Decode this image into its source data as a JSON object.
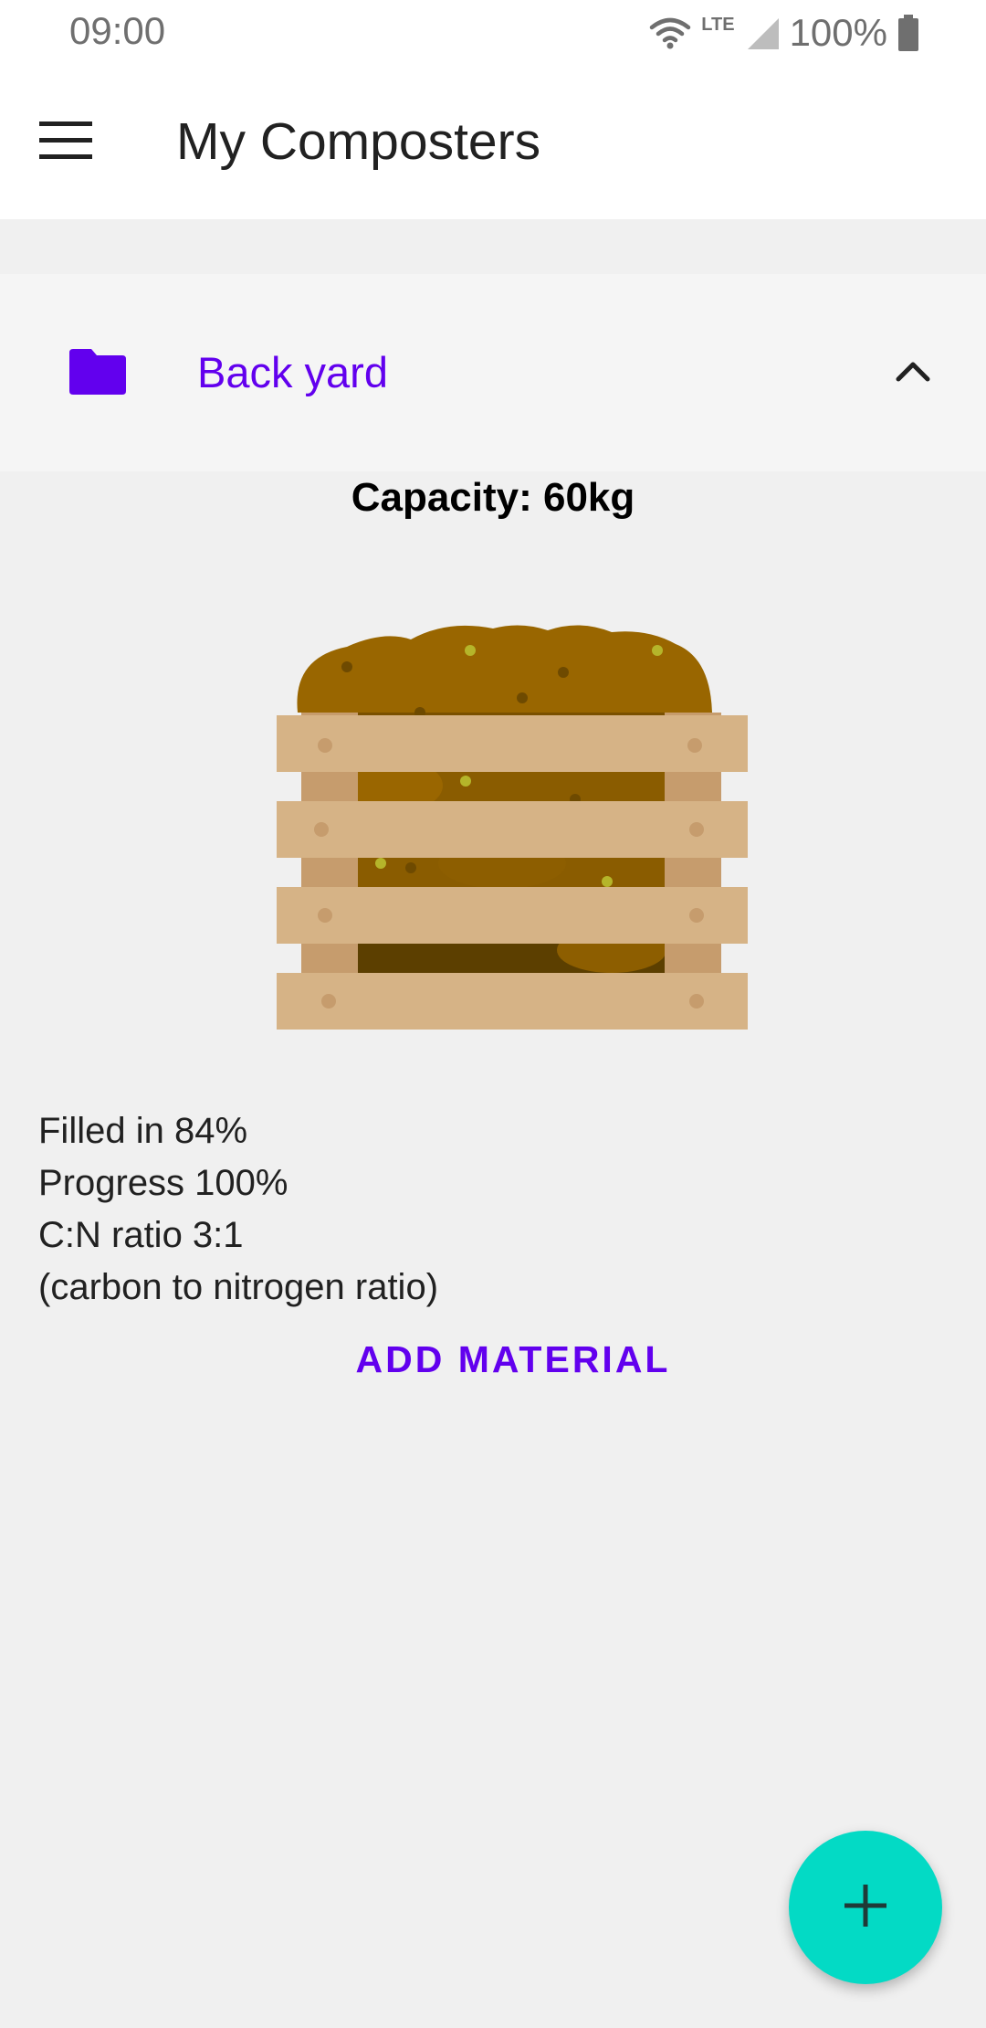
{
  "status_bar": {
    "time": "09:00",
    "network": "LTE",
    "battery": "100%",
    "icons": [
      "wifi-icon",
      "signal-icon",
      "battery-icon"
    ]
  },
  "app_bar": {
    "title": "My Composters",
    "menu_icon": "hamburger-menu-icon"
  },
  "group": {
    "title": "Back yard",
    "icon": "folder-icon",
    "expand_icon": "chevron-up-icon",
    "accent_color": "#6200ee"
  },
  "composter": {
    "capacity": "Capacity: 60kg",
    "image": "wooden-compost-crate",
    "filled": "Filled in 84%",
    "progress": "Progress 100%",
    "cn_ratio": "C:N ratio 3:1",
    "cn_note": "(carbon to nitrogen ratio)",
    "add_material_label": "ADD MATERIAL"
  },
  "fab": {
    "icon": "plus-icon",
    "color": "#03dac5"
  }
}
